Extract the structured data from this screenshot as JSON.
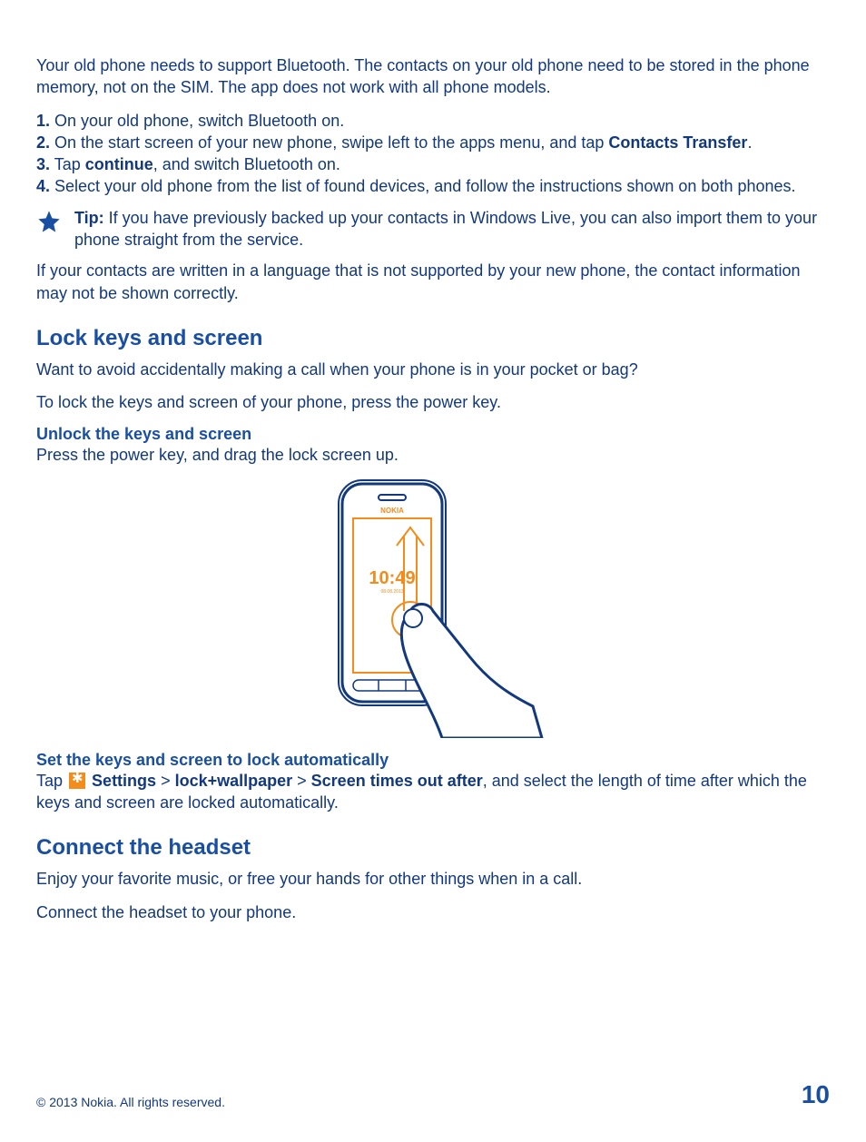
{
  "intro_paragraph": "Your old phone needs to support Bluetooth. The contacts on your old phone need to be stored in the phone memory, not on the SIM. The app does not work with all phone models.",
  "steps": [
    {
      "num": "1.",
      "text": " On your old phone, switch Bluetooth on."
    },
    {
      "num": "2.",
      "pre": " On the start screen of your new phone, swipe left to the apps menu, and tap ",
      "bold": "Contacts Transfer",
      "post": "."
    },
    {
      "num": "3.",
      "pre": " Tap ",
      "bold": "continue",
      "post": ", and switch Bluetooth on."
    },
    {
      "num": "4.",
      "text": " Select your old phone from the list of found devices, and follow the instructions shown on both phones."
    }
  ],
  "tip": {
    "label": "Tip:",
    "text": " If you have previously backed up your contacts in Windows Live, you can also import them to your phone straight from the service."
  },
  "lang_note": "If your contacts are written in a language that is not supported by your new phone, the contact information may not be shown correctly.",
  "lock": {
    "heading": "Lock keys and screen",
    "p1": "Want to avoid accidentally making a call when your phone is in your pocket or bag?",
    "p2": "To lock the keys and screen of your phone, press the power key.",
    "sub1_title": "Unlock the keys and screen",
    "sub1_text": "Press the power key, and drag the lock screen up.",
    "sub2_title": "Set the keys and screen to lock automatically",
    "sub2_pre": "Tap ",
    "sub2_settings": "Settings",
    "sub2_sep1": " > ",
    "sub2_lockwp": "lock+wallpaper",
    "sub2_sep2": " > ",
    "sub2_screen": "Screen times out after",
    "sub2_post": ", and select the length of time after which the keys and screen are locked automatically.",
    "illustration_time": "10:49"
  },
  "headset": {
    "heading": "Connect the headset",
    "p1": "Enjoy your favorite music, or free your hands for other things when in a call.",
    "p2": "Connect the headset to your phone."
  },
  "footer": {
    "copyright": "© 2013 Nokia. All rights reserved.",
    "page_number": "10"
  }
}
